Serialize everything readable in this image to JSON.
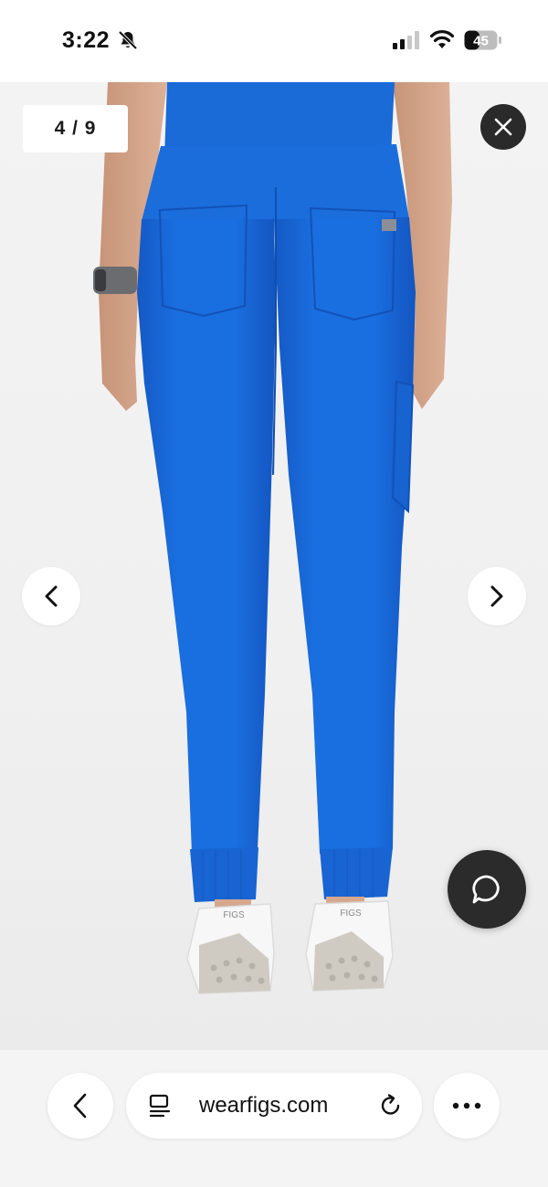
{
  "status_bar": {
    "time": "3:22",
    "battery": "45",
    "icons": [
      "bell-muted-icon",
      "cellular-signal-icon",
      "wifi-icon",
      "battery-icon"
    ]
  },
  "gallery": {
    "counter": "4 / 9",
    "product_image": "product-photo-blue-jogger-scrub-pants-back-view",
    "shoe_brand_left": "FIGS",
    "shoe_brand_right": "FIGS",
    "pants_color": "#1a6fe0",
    "icons": [
      "close-icon",
      "chevron-left-icon",
      "chevron-right-icon",
      "chat-bubble-icon"
    ]
  },
  "browser": {
    "url": "wearfigs.com",
    "icons": [
      "back-arrow-icon",
      "reader-mode-icon",
      "reload-icon",
      "more-dots-icon"
    ]
  }
}
